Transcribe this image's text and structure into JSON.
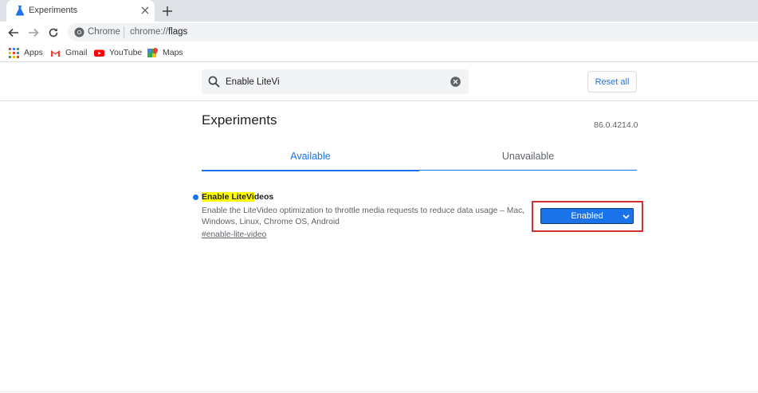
{
  "browser": {
    "tab_title": "Experiments",
    "omnibox_chip": "Chrome",
    "url_prefix": "chrome://",
    "url_path": "flags"
  },
  "bookmarks": [
    {
      "label": "Apps",
      "icon": "apps-grid-icon"
    },
    {
      "label": "Gmail",
      "icon": "gmail-icon"
    },
    {
      "label": "YouTube",
      "icon": "youtube-icon"
    },
    {
      "label": "Maps",
      "icon": "maps-icon"
    }
  ],
  "flags": {
    "search_value": "Enable LiteVi",
    "reset_label": "Reset all",
    "title": "Experiments",
    "version": "86.0.4214.0",
    "tabs": [
      {
        "label": "Available",
        "active": true
      },
      {
        "label": "Unavailable",
        "active": false
      }
    ],
    "experiment": {
      "name_highlight": "Enable LiteVi",
      "name_rest": "deos",
      "description": "Enable the LiteVideo optimization to throttle media requests to reduce data usage – Mac, Windows, Linux, Chrome OS, Android",
      "link": "#enable-lite-video",
      "state": "Enabled"
    }
  },
  "colors": {
    "accent": "#1a73e8",
    "highlight": "#ffff00",
    "annotation_frame": "#d32f2f"
  }
}
